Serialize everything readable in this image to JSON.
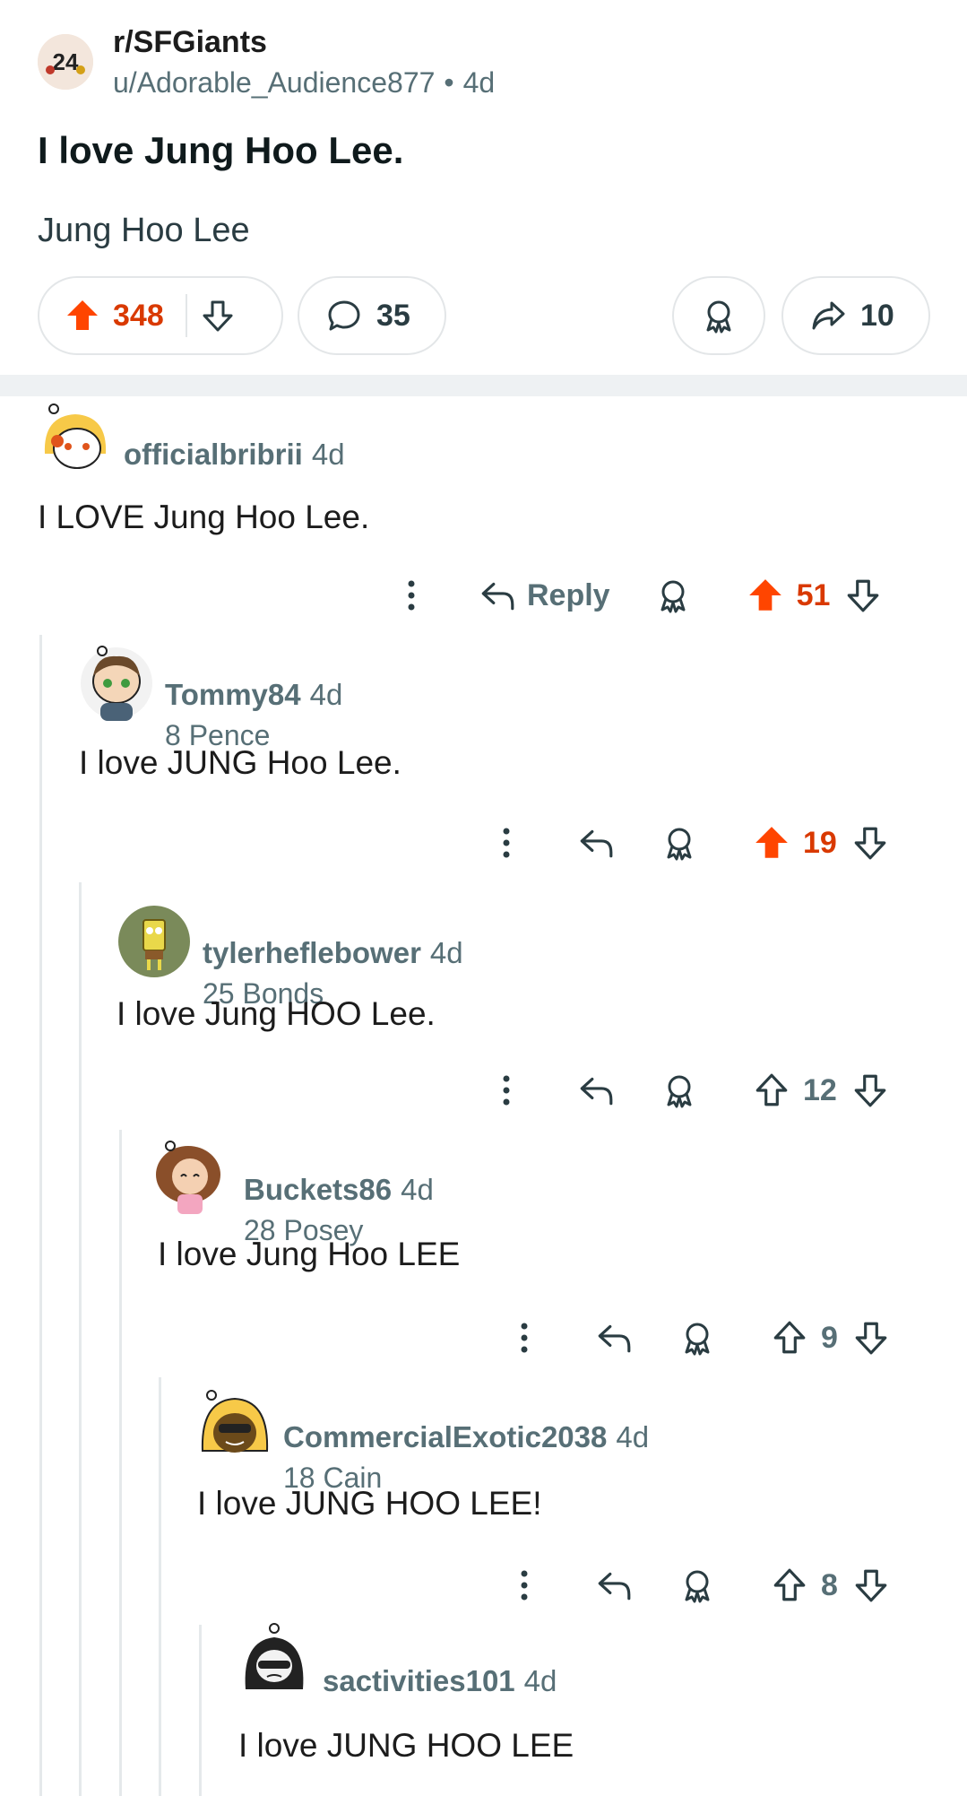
{
  "post": {
    "subreddit": "r/SFGiants",
    "author": "u/Adorable_Audience877",
    "separator": "•",
    "age": "4d",
    "subreddit_icon_text": "24",
    "title": "I love Jung Hoo Lee.",
    "body": "Jung Hoo Lee",
    "upvotes": "348",
    "comments": "35",
    "shares": "10"
  },
  "comments": [
    {
      "user": "officialbribrii",
      "age": "4d",
      "flair": "",
      "text": "I LOVE Jung Hoo Lee.",
      "reply_label": "Reply",
      "score": "51",
      "upvoted": true
    },
    {
      "user": "Tommy84",
      "age": "4d",
      "flair": "8 Pence",
      "text": "I love JUNG Hoo Lee.",
      "score": "19",
      "upvoted": true
    },
    {
      "user": "tylerheflebower",
      "age": "4d",
      "flair": "25 Bonds",
      "text": "I love Jung HOO Lee.",
      "score": "12",
      "upvoted": false
    },
    {
      "user": "Buckets86",
      "age": "4d",
      "flair": "28 Posey",
      "text": "I love Jung Hoo LEE",
      "score": "9",
      "upvoted": false
    },
    {
      "user": "CommercialExotic2038",
      "age": "4d",
      "flair": "18 Cain",
      "text": "I love JUNG HOO LEE!",
      "score": "8",
      "upvoted": false
    },
    {
      "user": "sactivities101",
      "age": "4d",
      "flair": "",
      "text": "I love JUNG HOO LEE"
    }
  ],
  "colors": {
    "upvote": "#ff4500",
    "score_active": "#d93900",
    "meta": "#576f76",
    "border": "#e3e6e8"
  },
  "icons": [
    "upvote-icon",
    "downvote-icon",
    "comment-icon",
    "award-icon",
    "share-icon",
    "more-icon",
    "reply-icon"
  ]
}
